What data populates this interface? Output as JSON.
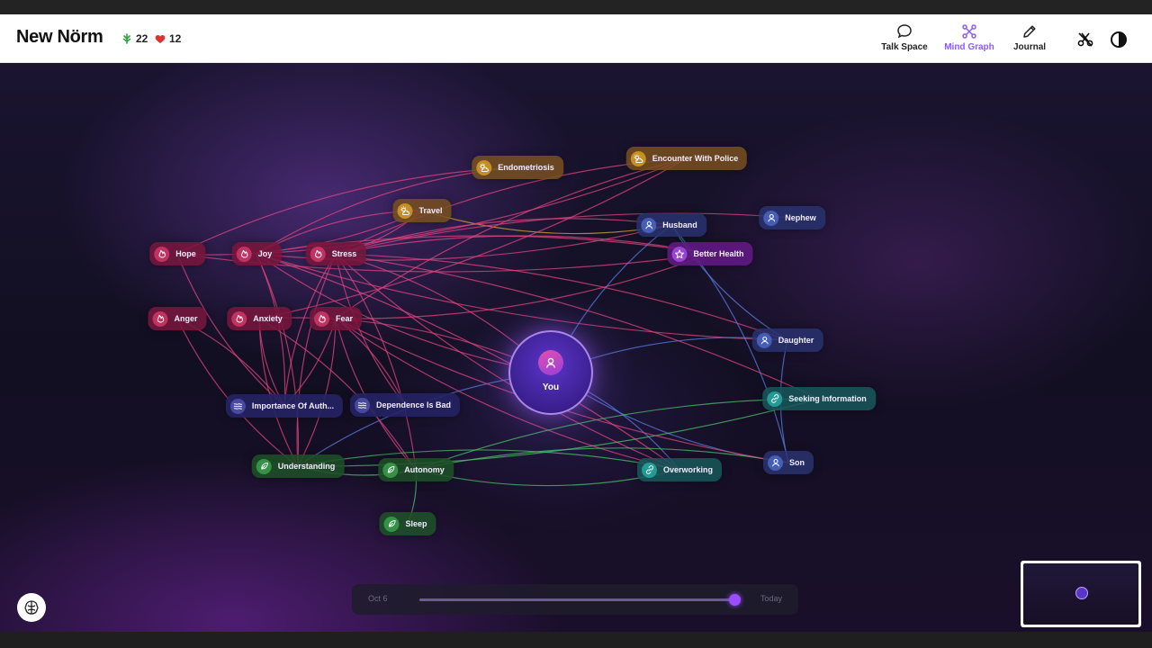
{
  "app": {
    "logo": "New Nörm",
    "stats": [
      {
        "icon": "leaf-icon",
        "value": "22",
        "color": "#2f9e44"
      },
      {
        "icon": "heart-icon",
        "value": "12",
        "color": "#e03131"
      }
    ]
  },
  "nav": {
    "items": [
      {
        "label": "Talk Space",
        "icon": "chat-bubble-icon",
        "active": false
      },
      {
        "label": "Mind Graph",
        "icon": "graph-icon",
        "active": true
      },
      {
        "label": "Journal",
        "icon": "pencil-icon",
        "active": false
      }
    ],
    "accent": "#8b5cf6"
  },
  "graph": {
    "center": {
      "label": "You",
      "icon": "user-icon"
    },
    "nodes": [
      {
        "id": "endometriosis",
        "label": "Endometriosis",
        "type": "event",
        "icon": "sun-cloud-icon"
      },
      {
        "id": "police",
        "label": "Encounter With Police",
        "type": "event",
        "icon": "sun-cloud-icon"
      },
      {
        "id": "travel",
        "label": "Travel",
        "type": "event",
        "icon": "sun-cloud-icon"
      },
      {
        "id": "husband",
        "label": "Husband",
        "type": "person",
        "icon": "user-icon"
      },
      {
        "id": "nephew",
        "label": "Nephew",
        "type": "person",
        "icon": "user-icon"
      },
      {
        "id": "betterhealth",
        "label": "Better Health",
        "type": "goal",
        "icon": "star-icon"
      },
      {
        "id": "hope",
        "label": "Hope",
        "type": "emotion",
        "icon": "flame-icon"
      },
      {
        "id": "joy",
        "label": "Joy",
        "type": "emotion",
        "icon": "flame-icon"
      },
      {
        "id": "stress",
        "label": "Stress",
        "type": "emotion",
        "icon": "flame-icon"
      },
      {
        "id": "anger",
        "label": "Anger",
        "type": "emotion",
        "icon": "flame-icon"
      },
      {
        "id": "anxiety",
        "label": "Anxiety",
        "type": "emotion",
        "icon": "flame-icon"
      },
      {
        "id": "fear",
        "label": "Fear",
        "type": "emotion",
        "icon": "flame-icon"
      },
      {
        "id": "daughter",
        "label": "Daughter",
        "type": "person",
        "icon": "user-icon"
      },
      {
        "id": "seeking",
        "label": "Seeking Information",
        "type": "behavior",
        "icon": "link-icon"
      },
      {
        "id": "authenticity",
        "label": "Importance Of Auth...",
        "type": "belief",
        "icon": "waves-icon"
      },
      {
        "id": "dependence",
        "label": "Dependence Is Bad",
        "type": "belief",
        "icon": "waves-icon"
      },
      {
        "id": "understanding",
        "label": "Understanding",
        "type": "value",
        "icon": "leaf-icon"
      },
      {
        "id": "autonomy",
        "label": "Autonomy",
        "type": "value",
        "icon": "leaf-icon"
      },
      {
        "id": "overworking",
        "label": "Overworking",
        "type": "behavior",
        "icon": "link-icon"
      },
      {
        "id": "son",
        "label": "Son",
        "type": "person",
        "icon": "user-icon"
      },
      {
        "id": "sleep",
        "label": "Sleep",
        "type": "value",
        "icon": "leaf-icon"
      }
    ],
    "edges": [
      [
        "hope",
        "endometriosis"
      ],
      [
        "hope",
        "travel"
      ],
      [
        "joy",
        "travel"
      ],
      [
        "stress",
        "travel"
      ],
      [
        "joy",
        "endometriosis"
      ],
      [
        "travel",
        "husband"
      ],
      [
        "stress",
        "police"
      ],
      [
        "joy",
        "police"
      ],
      [
        "fear",
        "police"
      ],
      [
        "anxiety",
        "police"
      ],
      [
        "stress",
        "husband"
      ],
      [
        "joy",
        "husband"
      ],
      [
        "stress",
        "betterhealth"
      ],
      [
        "hope",
        "betterhealth"
      ],
      [
        "joy",
        "betterhealth"
      ],
      [
        "fear",
        "betterhealth"
      ],
      [
        "stress",
        "nephew"
      ],
      [
        "husband",
        "you"
      ],
      [
        "stress",
        "daughter"
      ],
      [
        "joy",
        "daughter"
      ],
      [
        "you",
        "daughter"
      ],
      [
        "husband",
        "daughter"
      ],
      [
        "husband",
        "son"
      ],
      [
        "daughter",
        "son"
      ],
      [
        "stress",
        "you"
      ],
      [
        "joy",
        "you"
      ],
      [
        "anxiety",
        "you"
      ],
      [
        "stress",
        "authenticity"
      ],
      [
        "joy",
        "authenticity"
      ],
      [
        "hope",
        "authenticity"
      ],
      [
        "anger",
        "authenticity"
      ],
      [
        "anxiety",
        "authenticity"
      ],
      [
        "fear",
        "authenticity"
      ],
      [
        "stress",
        "dependence"
      ],
      [
        "fear",
        "dependence"
      ],
      [
        "stress",
        "understanding"
      ],
      [
        "joy",
        "understanding"
      ],
      [
        "anxiety",
        "understanding"
      ],
      [
        "fear",
        "understanding"
      ],
      [
        "anger",
        "understanding"
      ],
      [
        "stress",
        "autonomy"
      ],
      [
        "fear",
        "autonomy"
      ],
      [
        "anxiety",
        "autonomy"
      ],
      [
        "stress",
        "overworking"
      ],
      [
        "joy",
        "overworking"
      ],
      [
        "fear",
        "overworking"
      ],
      [
        "you",
        "overworking"
      ],
      [
        "you",
        "son"
      ],
      [
        "understanding",
        "overworking"
      ],
      [
        "autonomy",
        "overworking"
      ],
      [
        "autonomy",
        "son"
      ],
      [
        "understanding",
        "seeking"
      ],
      [
        "autonomy",
        "seeking"
      ],
      [
        "understanding",
        "autonomy"
      ],
      [
        "autonomy",
        "sleep"
      ],
      [
        "you",
        "understanding"
      ],
      [
        "stress",
        "seeking"
      ],
      [
        "fear",
        "son"
      ]
    ],
    "type_colors": {
      "emotion": "#e0457f",
      "event": "#d9a53a",
      "person": "#5b7be0",
      "goal": "#b05ae8",
      "belief": "#6a6ad0",
      "value": "#4fbf6a",
      "behavior": "#3fbfb0"
    }
  },
  "timeline": {
    "start_label": "Oct 6",
    "end_label": "Today",
    "position": 1.0
  },
  "controls": {
    "brain_icon": "brain-icon",
    "header_icons": [
      "scissors-icon",
      "contrast-icon"
    ]
  }
}
